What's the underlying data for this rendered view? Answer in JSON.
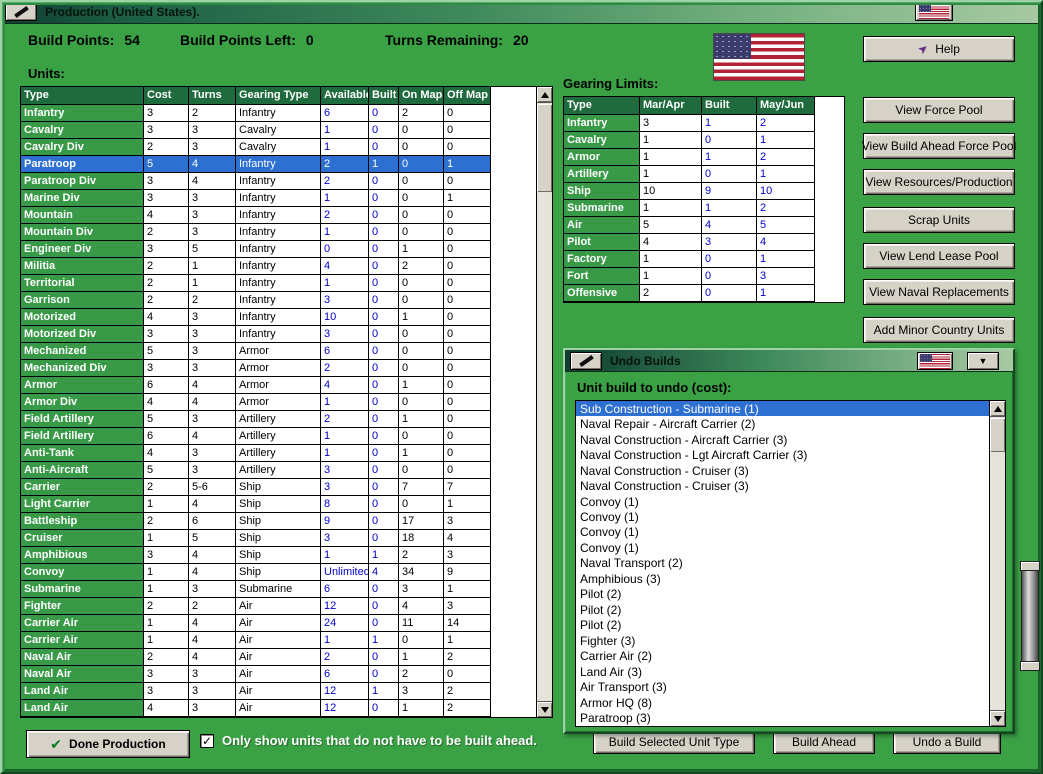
{
  "window": {
    "title": "Production (United States).",
    "help_label": "Help",
    "country": "United States"
  },
  "icons": {
    "help_arrow": "➤",
    "checkmark": "✔",
    "check": "✓",
    "collapse": "▼"
  },
  "topbar": {
    "build_points_label": "Build Points:",
    "build_points_value": "54",
    "build_points_left_label": "Build Points Left:",
    "build_points_left_value": "0",
    "turns_remaining_label": "Turns Remaining:",
    "turns_remaining_value": "20"
  },
  "units": {
    "label": "Units:",
    "headers": [
      "Type",
      "Cost",
      "Turns",
      "Gearing Type",
      "Available",
      "Built",
      "On Map",
      "Off Map"
    ],
    "selected_index": 3,
    "rows": [
      [
        "Infantry",
        "3",
        "2",
        "Infantry",
        "6",
        "0",
        "2",
        "0"
      ],
      [
        "Cavalry",
        "3",
        "3",
        "Cavalry",
        "1",
        "0",
        "0",
        "0"
      ],
      [
        "Cavalry Div",
        "2",
        "3",
        "Cavalry",
        "1",
        "0",
        "0",
        "0"
      ],
      [
        "Paratroop",
        "5",
        "4",
        "Infantry",
        "2",
        "1",
        "0",
        "1"
      ],
      [
        "Paratroop Div",
        "3",
        "4",
        "Infantry",
        "2",
        "0",
        "0",
        "0"
      ],
      [
        "Marine Div",
        "3",
        "3",
        "Infantry",
        "1",
        "0",
        "0",
        "1"
      ],
      [
        "Mountain",
        "4",
        "3",
        "Infantry",
        "2",
        "0",
        "0",
        "0"
      ],
      [
        "Mountain Div",
        "2",
        "3",
        "Infantry",
        "1",
        "0",
        "0",
        "0"
      ],
      [
        "Engineer Div",
        "3",
        "5",
        "Infantry",
        "0",
        "0",
        "1",
        "0"
      ],
      [
        "Militia",
        "2",
        "1",
        "Infantry",
        "4",
        "0",
        "2",
        "0"
      ],
      [
        "Territorial",
        "2",
        "1",
        "Infantry",
        "1",
        "0",
        "0",
        "0"
      ],
      [
        "Garrison",
        "2",
        "2",
        "Infantry",
        "3",
        "0",
        "0",
        "0"
      ],
      [
        "Motorized",
        "4",
        "3",
        "Infantry",
        "10",
        "0",
        "1",
        "0"
      ],
      [
        "Motorized Div",
        "3",
        "3",
        "Infantry",
        "3",
        "0",
        "0",
        "0"
      ],
      [
        "Mechanized",
        "5",
        "3",
        "Armor",
        "6",
        "0",
        "0",
        "0"
      ],
      [
        "Mechanized Div",
        "3",
        "3",
        "Armor",
        "2",
        "0",
        "0",
        "0"
      ],
      [
        "Armor",
        "6",
        "4",
        "Armor",
        "4",
        "0",
        "1",
        "0"
      ],
      [
        "Armor Div",
        "4",
        "4",
        "Armor",
        "1",
        "0",
        "0",
        "0"
      ],
      [
        "Field Artillery",
        "5",
        "3",
        "Artillery",
        "2",
        "0",
        "1",
        "0"
      ],
      [
        "Field Artillery",
        "6",
        "4",
        "Artillery",
        "1",
        "0",
        "0",
        "0"
      ],
      [
        "Anti-Tank",
        "4",
        "3",
        "Artillery",
        "1",
        "0",
        "1",
        "0"
      ],
      [
        "Anti-Aircraft",
        "5",
        "3",
        "Artillery",
        "3",
        "0",
        "0",
        "0"
      ],
      [
        "Carrier",
        "2",
        "5-6",
        "Ship",
        "3",
        "0",
        "7",
        "7"
      ],
      [
        "Light Carrier",
        "1",
        "4",
        "Ship",
        "8",
        "0",
        "0",
        "1"
      ],
      [
        "Battleship",
        "2",
        "6",
        "Ship",
        "9",
        "0",
        "17",
        "3"
      ],
      [
        "Cruiser",
        "1",
        "5",
        "Ship",
        "3",
        "0",
        "18",
        "4"
      ],
      [
        "Amphibious",
        "3",
        "4",
        "Ship",
        "1",
        "1",
        "2",
        "3"
      ],
      [
        "Convoy",
        "1",
        "4",
        "Ship",
        "Unlimited",
        "4",
        "34",
        "9"
      ],
      [
        "Submarine",
        "1",
        "3",
        "Submarine",
        "6",
        "0",
        "3",
        "1"
      ],
      [
        "Fighter",
        "2",
        "2",
        "Air",
        "12",
        "0",
        "4",
        "3"
      ],
      [
        "Carrier Air",
        "1",
        "4",
        "Air",
        "24",
        "0",
        "11",
        "14"
      ],
      [
        "Carrier Air",
        "1",
        "4",
        "Air",
        "1",
        "1",
        "0",
        "1"
      ],
      [
        "Naval Air",
        "2",
        "4",
        "Air",
        "2",
        "0",
        "1",
        "2"
      ],
      [
        "Naval Air",
        "3",
        "3",
        "Air",
        "6",
        "0",
        "2",
        "0"
      ],
      [
        "Land Air",
        "3",
        "3",
        "Air",
        "12",
        "1",
        "3",
        "2"
      ],
      [
        "Land Air",
        "4",
        "3",
        "Air",
        "12",
        "0",
        "1",
        "2"
      ]
    ]
  },
  "gearing": {
    "label": "Gearing Limits:",
    "headers": [
      "Type",
      "Mar/Apr",
      "Built",
      "May/Jun"
    ],
    "rows": [
      [
        "Infantry",
        "3",
        "1",
        "2"
      ],
      [
        "Cavalry",
        "1",
        "0",
        "1"
      ],
      [
        "Armor",
        "1",
        "1",
        "2"
      ],
      [
        "Artillery",
        "1",
        "0",
        "1"
      ],
      [
        "Ship",
        "10",
        "9",
        "10"
      ],
      [
        "Submarine",
        "1",
        "1",
        "2"
      ],
      [
        "Air",
        "5",
        "4",
        "5"
      ],
      [
        "Pilot",
        "4",
        "3",
        "4"
      ],
      [
        "Factory",
        "1",
        "0",
        "1"
      ],
      [
        "Fort",
        "1",
        "0",
        "3"
      ],
      [
        "Offensive",
        "2",
        "0",
        "1"
      ]
    ]
  },
  "side_buttons": [
    "View Force Pool",
    "View Build Ahead Force Pool",
    "View Resources/Production",
    "Scrap Units",
    "View Lend Lease Pool",
    "View Naval Replacements",
    "Add Minor Country Units"
  ],
  "undo": {
    "title": "Undo Builds",
    "label": "Unit build to undo (cost):",
    "selected_index": 0,
    "items": [
      "Sub Construction - Submarine (1)",
      "Naval Repair - Aircraft Carrier (2)",
      "Naval Construction - Aircraft Carrier (3)",
      "Naval Construction - Lgt Aircraft Carrier (3)",
      "Naval Construction - Cruiser (3)",
      "Naval Construction - Cruiser (3)",
      "Convoy (1)",
      "Convoy (1)",
      "Convoy (1)",
      "Convoy (1)",
      "Naval Transport (2)",
      "Amphibious (3)",
      "Pilot (2)",
      "Pilot (2)",
      "Pilot (2)",
      "Fighter (3)",
      "Carrier Air (2)",
      "Land Air (3)",
      "Air Transport (3)",
      "Armor HQ (8)",
      "Paratroop (3)"
    ]
  },
  "bottom": {
    "done_label": "Done Production",
    "filter_label": "Only show units that do not have to be built ahead.",
    "filter_checked": true,
    "build_selected_label": "Build Selected Unit Type",
    "build_ahead_label": "Build Ahead",
    "undo_build_label": "Undo a Build"
  },
  "colors": {
    "background_green": "#3BA145",
    "table_header_green": "#1F6B3E",
    "type_cell_green": "#389A47",
    "selection_blue": "#2E6FD2",
    "value_blue": "#0000CD",
    "button_face": "#D6D2C7"
  }
}
